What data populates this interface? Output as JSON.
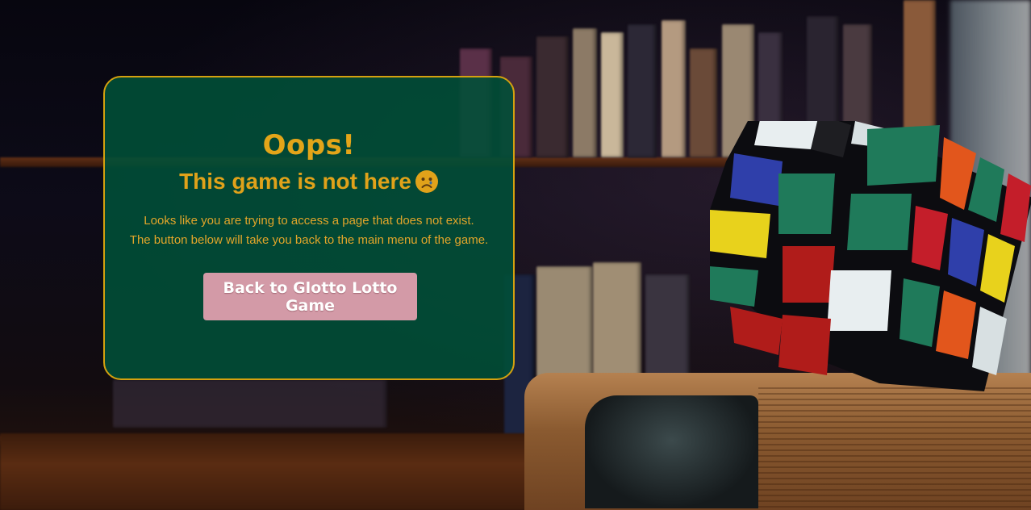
{
  "error_card": {
    "title": "Oops!",
    "subtitle": "This game is not here",
    "subtitle_icon": "sad-face-emoji",
    "message_line1": "Looks like you are trying to access a page that does not exist.",
    "message_line2": "The button below will take you back to the main menu of the game.",
    "back_button_label": "Back to Glotto Lotto Game"
  },
  "colors": {
    "card_background": "#005038",
    "card_border": "#d4a10f",
    "text_gold": "#e3a519",
    "button_background": "#d39aa7",
    "button_text": "#ffffff"
  },
  "background": {
    "description_icon": "bookshelf-rubiks-cube-photo"
  }
}
